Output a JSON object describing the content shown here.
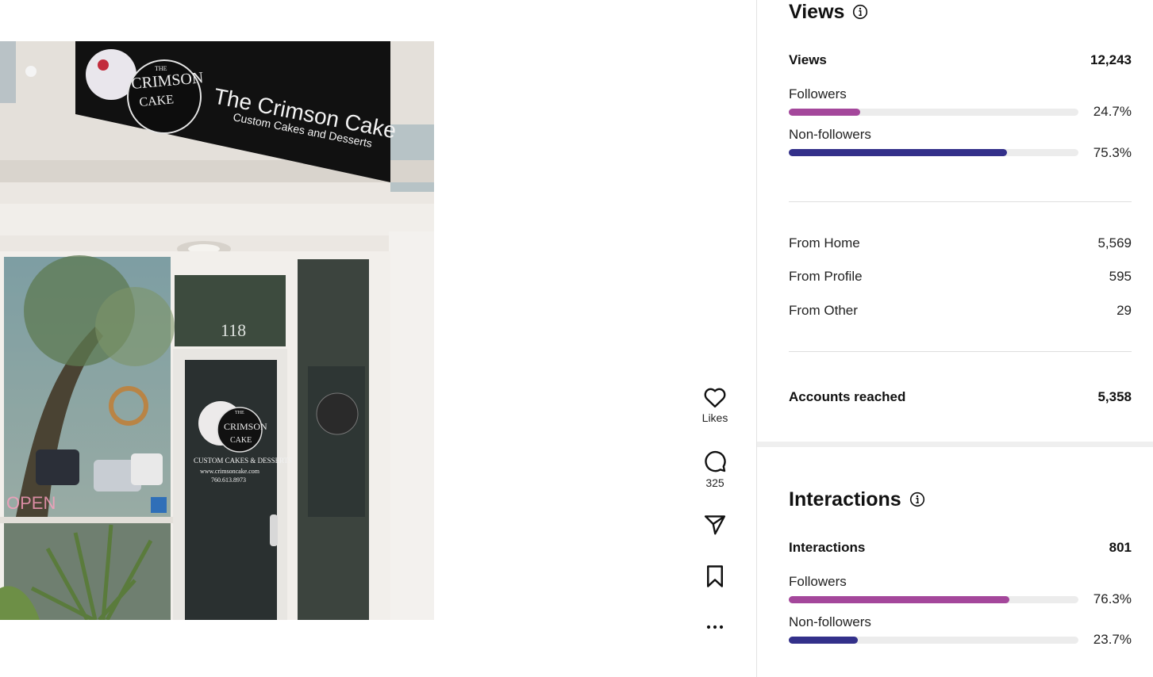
{
  "photo": {
    "sign_brand_line1": "THE",
    "sign_brand_line2": "CRIMSON",
    "sign_brand_line3": "CAKE",
    "sign_title": "The Crimson Cake",
    "sign_subtitle": "Custom Cakes and Desserts",
    "door_number": "118",
    "door_logo_line1": "THE",
    "door_logo_line2": "CRIMSON",
    "door_logo_line3": "CAKE",
    "door_text_line1": "CUSTOM CAKES & DESSERTS",
    "door_text_line2": "www.crimsoncake.com",
    "door_text_line3": "760.613.8973",
    "open_sign": "OPEN"
  },
  "actions": {
    "likes_label": "Likes",
    "comments_count": "325"
  },
  "views": {
    "title": "Views",
    "total_label": "Views",
    "total_value": "12,243",
    "followers_label": "Followers",
    "followers_pct": "24.7%",
    "followers_fraction": 0.247,
    "nonfollowers_label": "Non-followers",
    "nonfollowers_pct": "75.3%",
    "nonfollowers_fraction": 0.753,
    "sources": [
      {
        "label": "From Home",
        "value": "5,569"
      },
      {
        "label": "From Profile",
        "value": "595"
      },
      {
        "label": "From Other",
        "value": "29"
      }
    ],
    "reached_label": "Accounts reached",
    "reached_value": "5,358"
  },
  "interactions": {
    "title": "Interactions",
    "total_label": "Interactions",
    "total_value": "801",
    "followers_label": "Followers",
    "followers_pct": "76.3%",
    "followers_fraction": 0.763,
    "nonfollowers_label": "Non-followers",
    "nonfollowers_pct": "23.7%",
    "nonfollowers_fraction": 0.237
  },
  "colors": {
    "followers": "#a4479b",
    "nonfollowers": "#33308a",
    "track": "#ececec"
  }
}
